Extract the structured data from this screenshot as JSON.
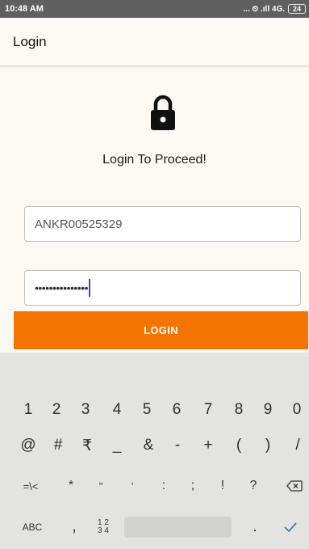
{
  "status_bar": {
    "time": "10:48 AM",
    "indicators": "... ⏲ .ıll 4G.",
    "battery": "24"
  },
  "app_bar": {
    "title": "Login"
  },
  "content": {
    "lock_icon": "lock-icon",
    "heading": "Login To Proceed!",
    "username_value": "ANKR00525329",
    "password_masked": "•••••••••••••••"
  },
  "login_button": {
    "label": "LOGIN",
    "color": "#f57300"
  },
  "keyboard": {
    "row_numbers": [
      "1",
      "2",
      "3",
      "4",
      "5",
      "6",
      "7",
      "8",
      "9",
      "0"
    ],
    "row_symbols": [
      "@",
      "#",
      "₹",
      "_",
      "&",
      "-",
      "+",
      "(",
      ")",
      "/"
    ],
    "row_symbols2": [
      "=\\<",
      "*",
      "\"",
      "'",
      ":",
      ";",
      "!",
      "?"
    ],
    "backspace_icon": "backspace-icon",
    "abc_label": "ABC",
    "comma_label": ",",
    "numpad_label": "1 2\n3 4",
    "period_label": ".",
    "enter_icon": "check-icon"
  }
}
